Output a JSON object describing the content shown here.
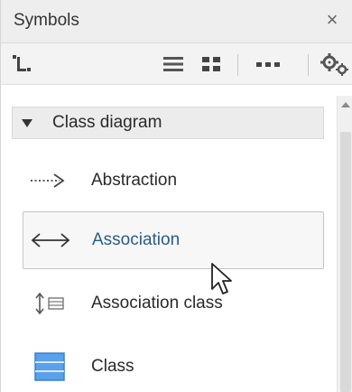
{
  "panel": {
    "title": "Symbols",
    "close_glyph": "×"
  },
  "toolbar": {
    "buttons": [
      {
        "icon": "tree-view-icon"
      },
      {
        "icon": "list-view-icon"
      },
      {
        "icon": "grid-view-icon"
      },
      {
        "icon": "more-options-icon"
      },
      {
        "icon": "settings-gears-icon"
      }
    ]
  },
  "section": {
    "label": "Class diagram",
    "expanded": true
  },
  "items": [
    {
      "label": "Abstraction",
      "icon": "dotted-arrow-icon",
      "selected": false
    },
    {
      "label": "Association",
      "icon": "bidirectional-arrow-icon",
      "selected": true
    },
    {
      "label": "Association class",
      "icon": "association-class-icon",
      "selected": false
    },
    {
      "label": "Class",
      "icon": "class-box-icon",
      "selected": false
    }
  ],
  "colors": {
    "accent_text": "#2a5d86",
    "class_icon_fill": "#4a90e2"
  }
}
